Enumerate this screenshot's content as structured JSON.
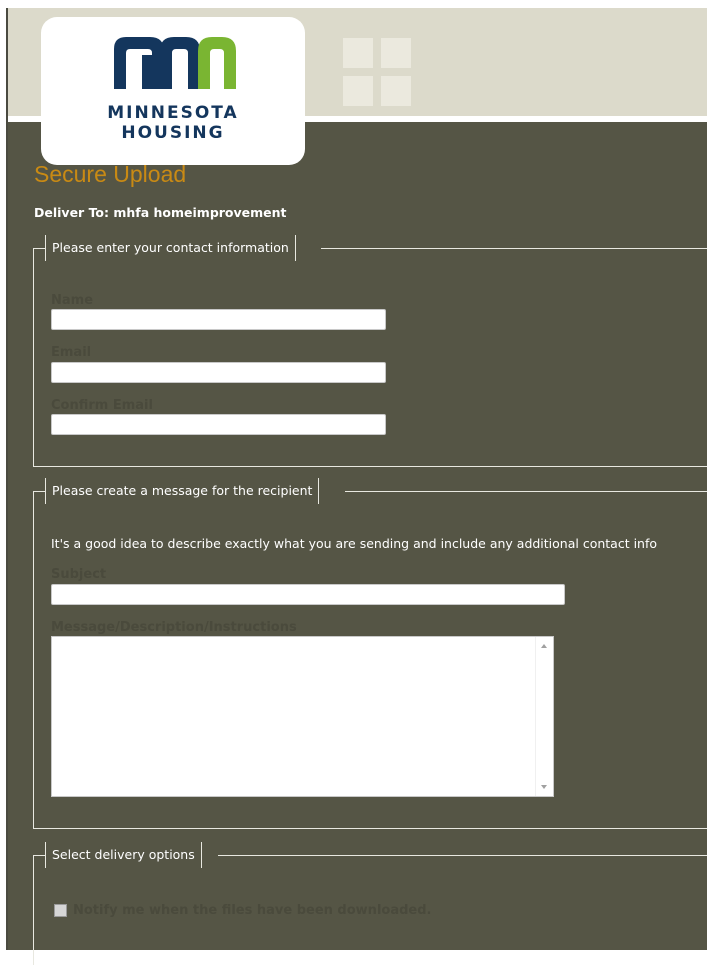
{
  "brand": {
    "logo_line1": "MINNESOTA",
    "logo_line2": "HOUSING",
    "colors": {
      "navy": "#14365d",
      "green": "#7ab532",
      "accent": "#c98a14",
      "panel": "#555545",
      "header": "#dcdacb"
    }
  },
  "page": {
    "title": "Secure Upload",
    "deliver_to": "Deliver To: mhfa homeimprovement"
  },
  "contact": {
    "legend": "Please enter your contact information",
    "name_label": "Name",
    "name_value": "",
    "email_label": "Email",
    "email_value": "",
    "confirm_email_label": "Confirm Email",
    "confirm_email_value": ""
  },
  "message": {
    "legend": "Please create a message for the recipient",
    "hint": "It's a good idea to describe exactly what you are sending and include any additional contact info",
    "subject_label": "Subject",
    "subject_value": "",
    "body_label": "Message/Description/Instructions",
    "body_value": ""
  },
  "delivery": {
    "legend": "Select delivery options",
    "notify_label": "Notify me when the files have been downloaded.",
    "notify_checked": false
  }
}
